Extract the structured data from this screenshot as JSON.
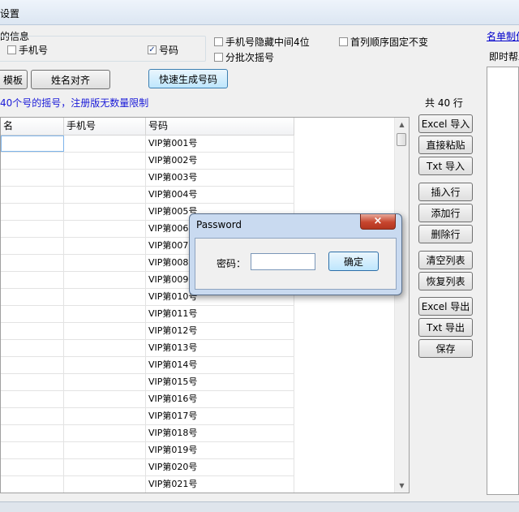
{
  "window": {
    "title": "设置"
  },
  "info_group": {
    "title": "的信息",
    "phone_label": "手机号",
    "phone_checked": false,
    "code_label": "号码",
    "code_checked": true
  },
  "options": {
    "hide_middle_label": "手机号隐藏中间4位",
    "hide_middle_checked": false,
    "batch_label": "分批次摇号",
    "batch_checked": false,
    "fix_order_label": "首列顺序固定不变",
    "fix_order_checked": false
  },
  "top_right_link": "名单制作",
  "side_panel_label": "即时帮助",
  "buttons": {
    "template": "模板",
    "align_names": "姓名对齐",
    "quick_generate": "快速生成号码",
    "excel_import": "Excel 导入",
    "paste": "直接粘贴",
    "txt_import": "Txt 导入",
    "insert_row": "插入行",
    "add_row": "添加行",
    "delete_row": "删除行",
    "clear_list": "清空列表",
    "restore_list": "恢复列表",
    "excel_export": "Excel 导出",
    "txt_export": "Txt 导出",
    "save": "保存"
  },
  "notice": "40个号的摇号，注册版无数量限制",
  "row_count": "共 40 行",
  "table": {
    "columns": [
      "名",
      "手机号",
      "号码"
    ],
    "rows": [
      [
        "",
        "",
        "VIP第001号"
      ],
      [
        "",
        "",
        "VIP第002号"
      ],
      [
        "",
        "",
        "VIP第003号"
      ],
      [
        "",
        "",
        "VIP第004号"
      ],
      [
        "",
        "",
        "VIP第005号"
      ],
      [
        "",
        "",
        "VIP第006号"
      ],
      [
        "",
        "",
        "VIP第007号"
      ],
      [
        "",
        "",
        "VIP第008号"
      ],
      [
        "",
        "",
        "VIP第009号"
      ],
      [
        "",
        "",
        "VIP第010号"
      ],
      [
        "",
        "",
        "VIP第011号"
      ],
      [
        "",
        "",
        "VIP第012号"
      ],
      [
        "",
        "",
        "VIP第013号"
      ],
      [
        "",
        "",
        "VIP第014号"
      ],
      [
        "",
        "",
        "VIP第015号"
      ],
      [
        "",
        "",
        "VIP第016号"
      ],
      [
        "",
        "",
        "VIP第017号"
      ],
      [
        "",
        "",
        "VIP第018号"
      ],
      [
        "",
        "",
        "VIP第019号"
      ],
      [
        "",
        "",
        "VIP第020号"
      ],
      [
        "",
        "",
        "VIP第021号"
      ]
    ]
  },
  "dialog": {
    "title": "Password",
    "close_icon": "×",
    "password_label": "密码：",
    "password_value": "",
    "ok_label": "确定"
  },
  "colors": {
    "notice_text": "#1a1ad8",
    "link": "#0000cc"
  }
}
